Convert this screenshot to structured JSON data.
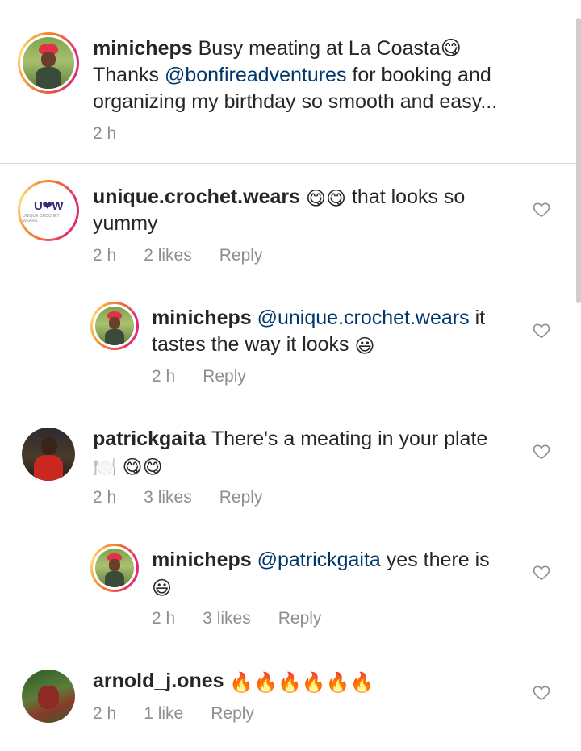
{
  "caption": {
    "username": "minicheps",
    "text_before": "Busy meating at La Coasta😋",
    "line2_prefix": "Thanks ",
    "mention": "@bonfireadventures",
    "line2_suffix": " for booking and",
    "line3": "organizing my birthday so smooth and easy...",
    "time": "2 h"
  },
  "comments": [
    {
      "username": "unique.crochet.wears",
      "emoji": "😋😋",
      "text": " that looks so",
      "text_line2": "yummy",
      "time": "2 h",
      "likes": "2 likes",
      "reply": "Reply",
      "avatar_logo": "U❤W",
      "avatar_sub": "UNIQUE CROCHET WEARS"
    },
    {
      "username": "minicheps",
      "mention": "@unique.crochet.wears",
      "text": " it",
      "text_line2": "tastes the way it looks ",
      "emoji": "😃",
      "time": "2 h",
      "reply": "Reply"
    },
    {
      "username": "patrickgaita",
      "text": " There's a meating in your plate",
      "text_line2_emoji": "🍽️ 😋😋",
      "time": "2 h",
      "likes": "3 likes",
      "reply": "Reply"
    },
    {
      "username": "minicheps",
      "mention": "@patrickgaita",
      "text": " yes there is",
      "emoji": "😃",
      "time": "2 h",
      "likes": "3 likes",
      "reply": "Reply"
    },
    {
      "username": "arnold_j.ones",
      "emoji": " 🔥🔥🔥🔥🔥🔥",
      "time": "2 h",
      "likes": "1 like",
      "reply": "Reply"
    }
  ],
  "icons": {
    "like": "heart-outline-icon"
  },
  "colors": {
    "mention": "#00376b",
    "meta": "#8e8e8e",
    "text": "#262626"
  }
}
